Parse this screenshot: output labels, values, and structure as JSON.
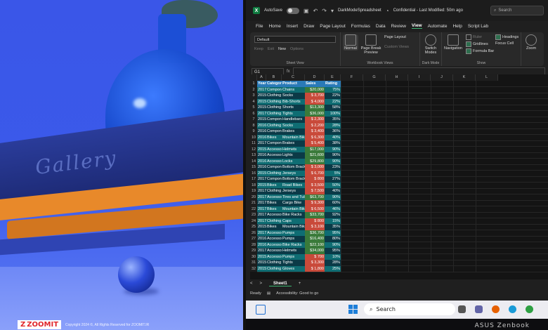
{
  "photo": {
    "book_text": "Gallery",
    "logo_text": "ZOOMIT",
    "copyright": "Copyright 2024 ©, All Rights Reserved for ZOOMIT.IR"
  },
  "titlebar": {
    "autosave": "AutoSave",
    "filename": "DarkModeSpreadsheet",
    "sensitivity": "Confidential - Last Modified: 50m ago",
    "search": "Search"
  },
  "menu": [
    "File",
    "Home",
    "Insert",
    "Draw",
    "Page Layout",
    "Formulas",
    "Data",
    "Review",
    "View",
    "Automate",
    "Help",
    "Script Lab"
  ],
  "menu_active": "View",
  "ribbon": {
    "sheet_view_dropdown": "Default",
    "sheet_view_buttons": [
      "Keep",
      "Exit",
      "New",
      "Options"
    ],
    "sheet_view_label": "Sheet View",
    "normal": "Normal",
    "page_break": "Page Break Preview",
    "page_layout": "Page Layout",
    "custom_views": "Custom Views",
    "workbook_views_label": "Workbook Views",
    "switch_modes": "Switch Modes",
    "dark_mode_label": "Dark Mode",
    "navigation": "Navigation",
    "ruler": "Ruler",
    "gridlines": "Gridlines",
    "formula_bar": "Formula Bar",
    "headings": "Headings",
    "focus_cell": "Focus Cell",
    "show_label": "Show",
    "zoom": "Zoom"
  },
  "formula_bar": {
    "namebox": "G1",
    "fx": "fx",
    "value": ""
  },
  "columns": [
    "A",
    "B",
    "C",
    "D",
    "E",
    "F",
    "G",
    "H",
    "I",
    "J",
    "K",
    "L"
  ],
  "table_headers": [
    "Year",
    "Category",
    "Product",
    "Sales",
    "Rating"
  ],
  "rows": [
    [
      "2017",
      "Components",
      "Chains",
      "$20,000",
      "75%"
    ],
    [
      "2015",
      "Clothing",
      "Socks",
      "$ 3,700",
      "22%"
    ],
    [
      "2015",
      "Clothing",
      "Bib-Shorts",
      "$ 4,000",
      "22%"
    ],
    [
      "2015",
      "Clothing",
      "Shorts",
      "$13,300",
      "58%"
    ],
    [
      "2017",
      "Clothing",
      "Tights",
      "$36,000",
      "100%"
    ],
    [
      "2015",
      "Components",
      "Handlebars",
      "$ 2,300",
      "35%"
    ],
    [
      "2016",
      "Clothing",
      "Socks",
      "$ 2,200",
      "28%"
    ],
    [
      "2016",
      "Components",
      "Brakes",
      "$ 3,400",
      "36%"
    ],
    [
      "2016",
      "Bikes",
      "Mountain Bikes",
      "$ 6,300",
      "40%"
    ],
    [
      "2017",
      "Components",
      "Brakes",
      "$ 5,400",
      "38%"
    ],
    [
      "2015",
      "Accessories",
      "Helmets",
      "$17,000",
      "90%"
    ],
    [
      "2016",
      "Accessories",
      "Lights",
      "$21,600",
      "90%"
    ],
    [
      "2016",
      "Accessories",
      "Locks",
      "$29,800",
      "90%"
    ],
    [
      "2016",
      "Components",
      "Bottom Brackets",
      "$ 3,000",
      "23%"
    ],
    [
      "2015",
      "Clothing",
      "Jerseys",
      "$ 6,700",
      "5%"
    ],
    [
      "2017",
      "Components",
      "Bottom Brackets",
      "$ 800",
      "27%"
    ],
    [
      "2015",
      "Bikes",
      "Road Bikes",
      "$ 3,500",
      "50%"
    ],
    [
      "2017",
      "Clothing",
      "Jerseys",
      "$ 7,500",
      "40%"
    ],
    [
      "2017",
      "Accessories",
      "Tires and Tubes",
      "$63,700",
      "90%"
    ],
    [
      "2017",
      "Bikes",
      "Cargo Bike",
      "$ 9,300",
      "60%"
    ],
    [
      "2017",
      "Bikes",
      "Mountain Bikes",
      "$ 6,500",
      "46%"
    ],
    [
      "2017",
      "Accessories",
      "Bike Racks",
      "$33,700",
      "92%"
    ],
    [
      "2017",
      "Clothing",
      "Caps",
      "$ 800",
      "15%"
    ],
    [
      "2015",
      "Bikes",
      "Mountain Bikes",
      "$ 3,100",
      "35%"
    ],
    [
      "2017",
      "Accessories",
      "Pumps",
      "$36,700",
      "95%"
    ],
    [
      "2016",
      "Accessories",
      "Pumps",
      "$16,400",
      "80%"
    ],
    [
      "2016",
      "Accessories",
      "Bike Racks",
      "$22,100",
      "90%"
    ],
    [
      "2017",
      "Accessories",
      "Helmets",
      "$34,000",
      "95%"
    ],
    [
      "2015",
      "Accessories",
      "Pumps",
      "$ 700",
      "10%"
    ],
    [
      "2015",
      "Clothing",
      "Tights",
      "$ 3,300",
      "28%"
    ],
    [
      "2015",
      "Clothing",
      "Gloves",
      "$ 1,800",
      "25%"
    ]
  ],
  "sheetbar": {
    "prev": "<",
    "next": ">",
    "tab": "Sheet1",
    "add": "+"
  },
  "status": {
    "ready": "Ready",
    "accessibility": "Accessibility: Good to go"
  },
  "taskbar": {
    "search": "Search"
  },
  "device_brand": "ASUS Zenbook",
  "colors": {
    "teal_row": "#0f6d73",
    "dark_row": "#0b3a47",
    "sales_high": "#3a7a3a",
    "sales_low": "#c94a3a",
    "header_blue": "#2a7ab8"
  }
}
